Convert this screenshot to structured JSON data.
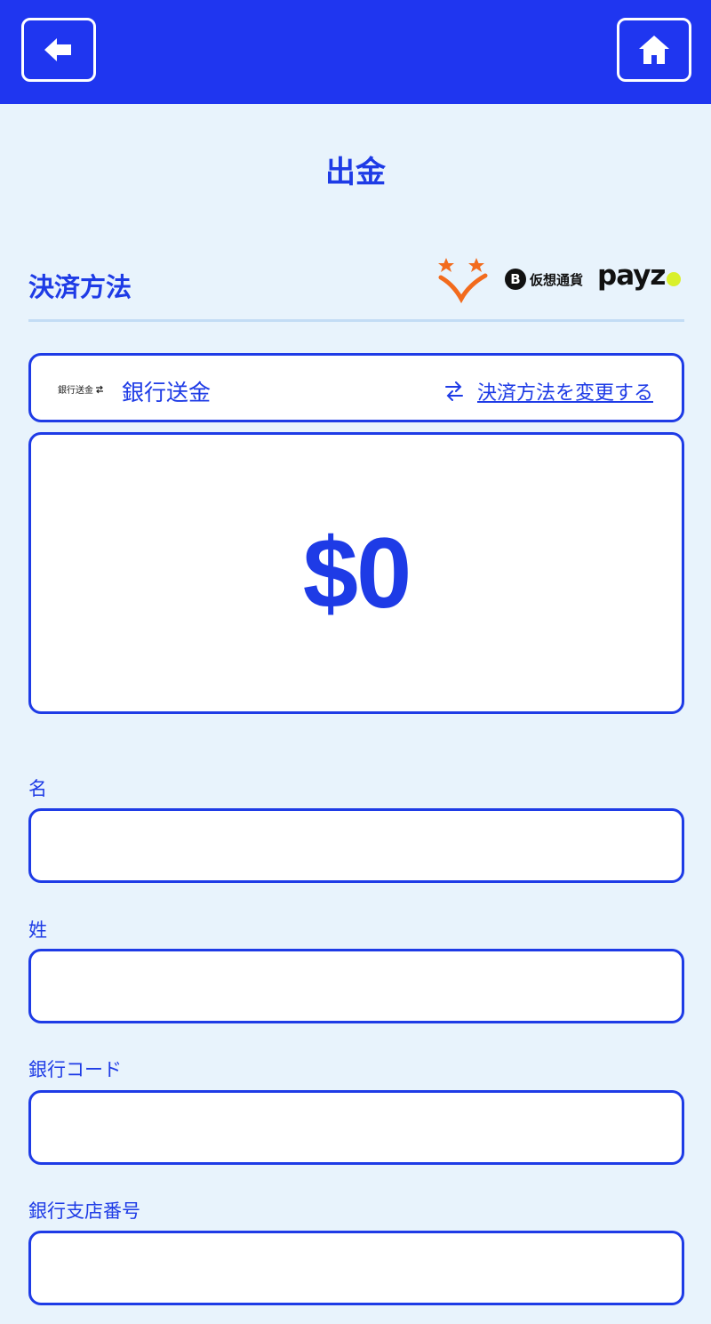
{
  "header": {
    "back_icon": "arrow-left-icon",
    "home_icon": "home-icon",
    "bg_color": "#1f36f0"
  },
  "page": {
    "title": "出金"
  },
  "payment_section": {
    "title": "決済方法",
    "logos": {
      "stars_icon": "stars-checkmark-icon",
      "crypto_label": "仮想通貨",
      "crypto_symbol": "B",
      "payz_label": "payz"
    }
  },
  "method": {
    "mini_label": "銀行送金",
    "name": "銀行送金",
    "change_label": "決済方法を変更する",
    "change_icon": "swap-arrows-icon"
  },
  "amount": {
    "value": "$0"
  },
  "form": {
    "fields": [
      {
        "label": "名",
        "value": ""
      },
      {
        "label": "姓",
        "value": ""
      },
      {
        "label": "銀行コード",
        "value": ""
      },
      {
        "label": "銀行支店番号",
        "value": ""
      }
    ]
  },
  "colors": {
    "accent": "#1e3be6",
    "background": "#e8f3fc",
    "star": "#f26b1d",
    "payz_dot": "#d9f02b"
  }
}
